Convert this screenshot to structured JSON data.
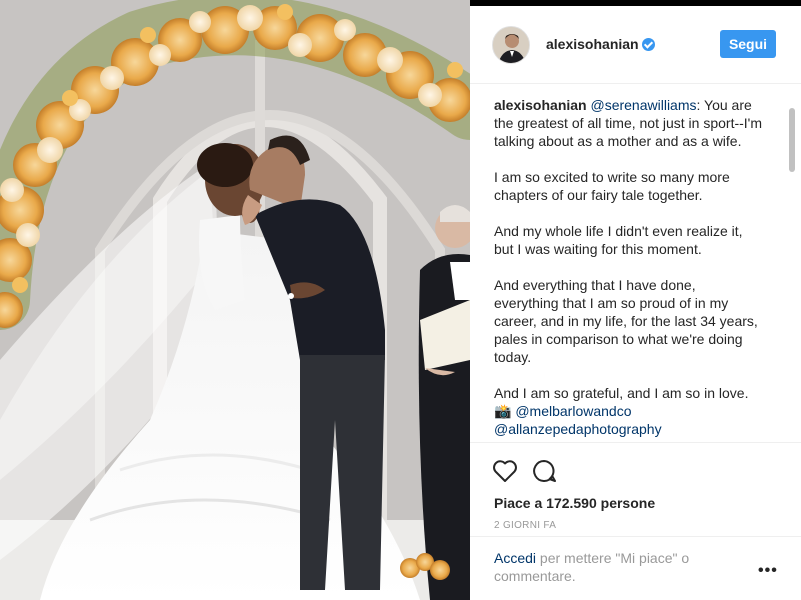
{
  "post": {
    "username": "alexisohanian",
    "follow_label": "Segui",
    "caption": {
      "author": "alexisohanian",
      "mention": "@serenawilliams",
      "line1_rest": ": You are the greatest of all time, not just in sport--I'm talking about as a mother and as a wife.",
      "para2": "I am so excited to write so many more chapters of our fairy tale together.",
      "para3": "And my whole life I didn't even realize it, but I was waiting for this moment.",
      "para4": "And everything that I have done, everything that I am so proud of in my career, and in my life, for the last 34 years, pales in comparison to what we're doing today.",
      "para5": "And I am so grateful, and I am so in love.",
      "camera_emoji": "📸",
      "credit1": "@melbarlowandco",
      "credit2": "@allanzepedaphotography"
    },
    "likes_text": "Piace a 172.590 persone",
    "time_text": "2 GIORNI FA",
    "login_link": "Accedi",
    "comment_prompt": " per mettere \"Mi piace\" o commentare.",
    "more_label": "•••"
  },
  "icons": {
    "like": "heart-outline-icon",
    "comment": "speech-bubble-icon",
    "verified": "verified-badge-icon"
  },
  "colors": {
    "accent": "#3897f0",
    "link": "#003569",
    "muted": "#999999"
  }
}
